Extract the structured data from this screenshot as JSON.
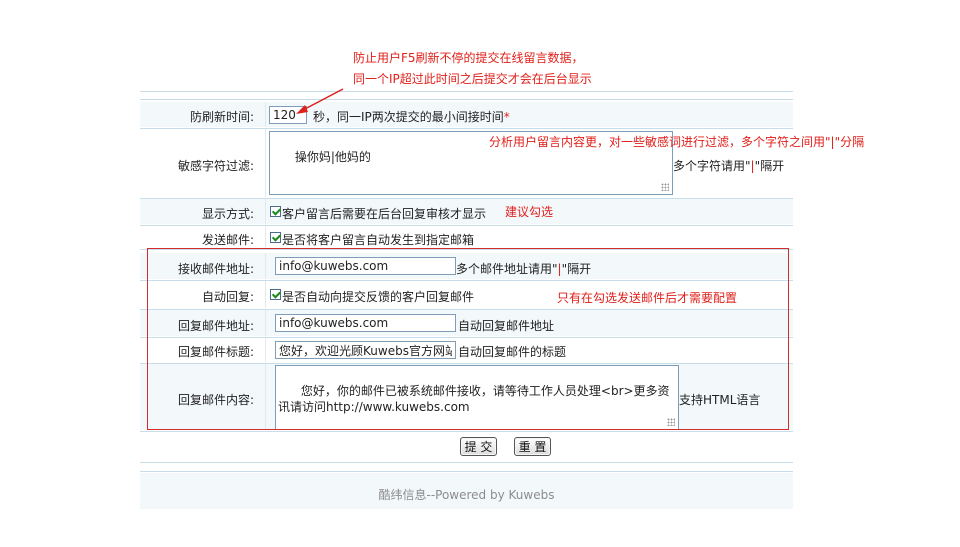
{
  "annotations": {
    "top_line1": "防止用户F5刷新不停的提交在线留言数据，",
    "top_line2": "同一个IP超过此时间之后提交才会在后台显示",
    "filter_note": "分析用户留言内容更，对一些敏感词进行过滤，多个字符之间用\"|\"分隔",
    "display_note": "建议勾选",
    "email_note": "只有在勾选发送邮件后才需要配置"
  },
  "form": {
    "refresh": {
      "label": "防刷新时间:",
      "value": "120",
      "hint": "秒，同一IP两次提交的最小间接时间",
      "required_mark": "*"
    },
    "filter": {
      "label": "敏感字符过滤:",
      "value": "操你妈|他妈的",
      "hint_prefix": "多个字符请用\"",
      "hint_pipe": "|",
      "hint_suffix": "\"隔开"
    },
    "display": {
      "label": "显示方式:",
      "checked": true,
      "text": "客户留言后需要在后台回复审核才显示"
    },
    "send_mail": {
      "label": "发送邮件:",
      "checked": true,
      "text": "是否将客户留言自动发生到指定邮箱"
    },
    "receive_addr": {
      "label": "接收邮件地址:",
      "value": "info@kuwebs.com",
      "hint_prefix": "多个邮件地址请用\"",
      "hint_pipe": "|",
      "hint_suffix": "\"隔开"
    },
    "auto_reply": {
      "label": "自动回复:",
      "checked": true,
      "text": "是否自动向提交反馈的客户回复邮件"
    },
    "reply_addr": {
      "label": "回复邮件地址:",
      "value": "info@kuwebs.com",
      "hint": "自动回复邮件地址"
    },
    "reply_title": {
      "label": "回复邮件标题:",
      "value": "您好，欢迎光顾Kuwebs官方网站",
      "hint": "自动回复邮件的标题"
    },
    "reply_content": {
      "label": "回复邮件内容:",
      "value": "您好，你的邮件已被系统邮件接收，请等待工作人员处理<br>更多资讯请访问http://www.kuwebs.com",
      "hint": "支持HTML语言"
    },
    "buttons": {
      "submit": "提 交",
      "reset": "重 置"
    }
  },
  "footer": {
    "text": "酷纬信息--Powered by Kuwebs"
  },
  "colors": {
    "annotation": "#e0201a",
    "row_alt": "#f3f8fb",
    "border": "#c7dde9"
  }
}
